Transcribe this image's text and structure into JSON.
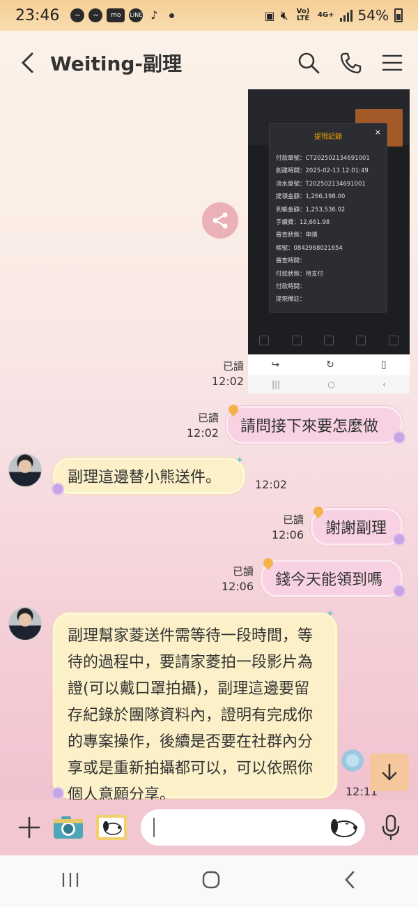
{
  "status_bar": {
    "time": "23:46",
    "network": "Vo) LTE",
    "data": "4G+",
    "battery": "54%"
  },
  "header": {
    "title": "Weiting-副理"
  },
  "screenshot": {
    "modal_title": "提現記錄",
    "close": "×",
    "rows": [
      "付款單號：CT202502134691001",
      "創建時間：2025-02-13 12:01:49",
      "流水單號：T202502134691001",
      "提領金額：1,266,198.00",
      "到帳金額：1,253,536.02",
      "手續費：12,661.98",
      "審查狀態：申請",
      "帳號：0842968021654",
      "審查時間：",
      "付款狀態：待支付",
      "付款時間：",
      "提現備註："
    ],
    "meta": {
      "read": "已讀",
      "time": "12:02"
    }
  },
  "messages": [
    {
      "id": "m1",
      "side": "out",
      "text": "請問接下來要怎麼做",
      "read": "已讀",
      "time": "12:02"
    },
    {
      "id": "m2",
      "side": "in",
      "text": "副理這邊替小熊送件。",
      "time": "12:02"
    },
    {
      "id": "m3",
      "side": "out",
      "text": "謝謝副理",
      "read": "已讀",
      "time": "12:06"
    },
    {
      "id": "m4",
      "side": "out",
      "text": "錢今天能領到嗎",
      "read": "已讀",
      "time": "12:06"
    },
    {
      "id": "m5",
      "side": "in",
      "text": "副理幫家菱送件需等待一段時間，等待的過程中，要請家菱拍一段影片為證(可以戴口罩拍攝)，副理這邊要留存紀錄於團隊資料內，證明有完成你的專案操作，後續是否要在社群內分享或是重新拍攝都可以，可以依照你個人意願分享。",
      "time": "12:11"
    }
  ],
  "colors": {
    "outgoing_bubble": "#f8d2e2",
    "incoming_bubble": "#fbf0c8",
    "status_bar": "#f6cf95",
    "input_bar": "#f3c7d2"
  },
  "icons": [
    "back-icon",
    "search-icon",
    "phone-icon",
    "menu-icon",
    "share-icon",
    "plus-icon",
    "camera-icon",
    "gallery-icon",
    "mic-icon",
    "scroll-down-icon"
  ]
}
